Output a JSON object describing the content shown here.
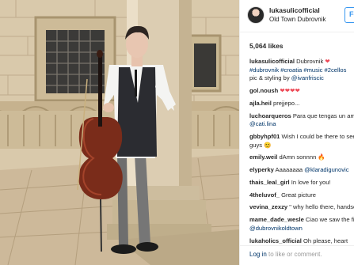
{
  "post": {
    "username": "lukasulicofficial",
    "location": "Old Town Dubrovnik",
    "follow_label": "Follow",
    "likes": "5,064 likes",
    "caption": {
      "user": "lukasulicofficial",
      "text_a": " Dubrovnik ",
      "hearts": "❤",
      "tags": "#dubrovnik #croatia #music #2cellos",
      "text_b": "pic & styling by ",
      "mention": "@ivanfriscic"
    },
    "comments": [
      {
        "user": "gol.noush",
        "text": "",
        "hearts": "❤❤❤❤"
      },
      {
        "user": "ajla.heil",
        "text": " prejjepo..."
      },
      {
        "user": "luchoarqueros",
        "text": " Para que tengas un amanecer ",
        "mention": "@cati.lina"
      },
      {
        "user": "gbbyhpf01",
        "text": " Wish I could be there to see you guys 😊"
      },
      {
        "user": "emily.weil",
        "text": " dAmn sonnnn 🔥"
      },
      {
        "user": "elyperky",
        "text": " Aaaaaaaa ",
        "mention": "@klaradigunovic"
      },
      {
        "user": "thais_leal_girl",
        "text": " In love for you!"
      },
      {
        "user": "4theluvof_",
        "text": " Great picture"
      },
      {
        "user": "vevina_zexzy",
        "text": " \" why hello there, handsome 😍"
      },
      {
        "user": "mame_dade_wesle",
        "text": " Ciao we saw the fine chap ",
        "mention": "@dubrovnikoldtown"
      },
      {
        "user": "lukaholics_official",
        "text": " Oh please, heart"
      }
    ],
    "footer": {
      "login": "Log in",
      "rest": " to like or comment."
    }
  },
  "colors": {
    "link": "#003569",
    "follow": "#3897f0",
    "heart": "#ed4956"
  },
  "icons": {
    "avatar": "profile-avatar"
  }
}
